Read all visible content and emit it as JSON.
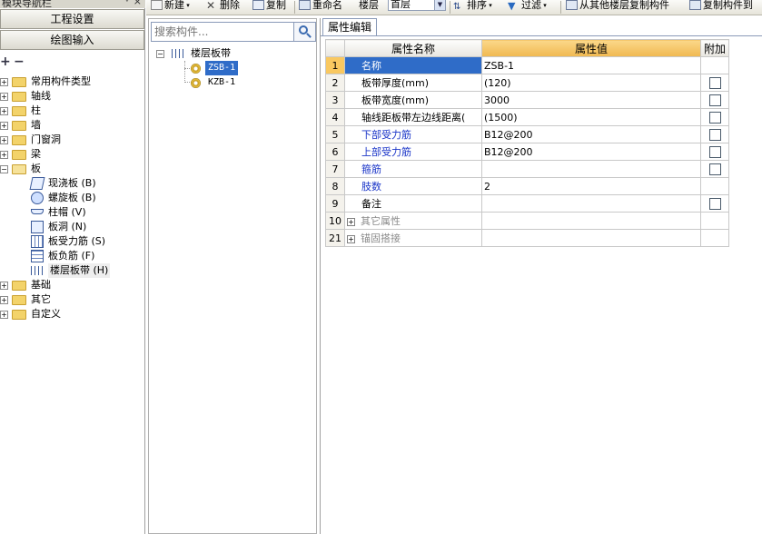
{
  "nav": {
    "title": "模块导航栏",
    "pin": "ᵠ",
    "close": "×",
    "project_settings": "工程设置",
    "drawing_input": "绘图输入",
    "tree": [
      {
        "label": "常用构件类型",
        "expanded": false
      },
      {
        "label": "轴线",
        "expanded": false
      },
      {
        "label": "柱",
        "expanded": false
      },
      {
        "label": "墙",
        "expanded": false
      },
      {
        "label": "门窗洞",
        "expanded": false
      },
      {
        "label": "梁",
        "expanded": false
      },
      {
        "label": "板",
        "expanded": true,
        "children": [
          {
            "label": "现浇板 (B)",
            "icon": "slab-icon"
          },
          {
            "label": "螺旋板 (B)",
            "icon": "spiral-slab-icon"
          },
          {
            "label": "柱帽 (V)",
            "icon": "column-cap-icon"
          },
          {
            "label": "板洞 (N)",
            "icon": "slab-hole-icon"
          },
          {
            "label": "板受力筋 (S)",
            "icon": "slab-rebar-icon"
          },
          {
            "label": "板负筋 (F)",
            "icon": "negative-rebar-icon"
          },
          {
            "label": "楼层板带 (H)",
            "icon": "floor-strip-icon",
            "selected": true
          }
        ]
      },
      {
        "label": "基础",
        "expanded": false
      },
      {
        "label": "其它",
        "expanded": false
      },
      {
        "label": "自定义",
        "expanded": false
      }
    ]
  },
  "toolbar": {
    "new": "新建",
    "delete": "删除",
    "copy": "复制",
    "rename": "重命名",
    "floor_label": "楼层",
    "floor_value": "首层",
    "sort": "排序",
    "filter": "过滤",
    "copy_from_floor": "从其他楼层复制构件",
    "copy_to": "复制构件到"
  },
  "components": {
    "search_placeholder": "搜索构件...",
    "group": "楼层板带",
    "items": [
      {
        "label": "ZSB-1",
        "selected": true
      },
      {
        "label": "KZB-1",
        "selected": false
      }
    ]
  },
  "properties": {
    "tab": "属性编辑",
    "headers": {
      "name": "属性名称",
      "value": "属性值",
      "extra": "附加"
    },
    "rows": [
      {
        "num": "1",
        "name": "名称",
        "value": "ZSB-1",
        "color": "blue",
        "checkbox": false,
        "selected": true
      },
      {
        "num": "2",
        "name": "板带厚度(mm)",
        "value": "(120)",
        "color": "black",
        "checkbox": true
      },
      {
        "num": "3",
        "name": "板带宽度(mm)",
        "value": "3000",
        "color": "black",
        "checkbox": true
      },
      {
        "num": "4",
        "name": "轴线距板带左边线距离(",
        "value": "(1500)",
        "color": "black",
        "checkbox": true
      },
      {
        "num": "5",
        "name": "下部受力筋",
        "value": "B12@200",
        "color": "blue",
        "checkbox": true
      },
      {
        "num": "6",
        "name": "上部受力筋",
        "value": "B12@200",
        "color": "blue",
        "checkbox": true
      },
      {
        "num": "7",
        "name": "箍筋",
        "value": "",
        "color": "blue",
        "checkbox": true
      },
      {
        "num": "8",
        "name": "肢数",
        "value": "2",
        "color": "blue",
        "checkbox": false
      },
      {
        "num": "9",
        "name": "备注",
        "value": "",
        "color": "black",
        "checkbox": true
      },
      {
        "num": "10",
        "name": "其它属性",
        "value": "",
        "color": "gray",
        "checkbox": false,
        "group": true
      },
      {
        "num": "21",
        "name": "锚固搭接",
        "value": "",
        "color": "gray",
        "checkbox": false,
        "group": true
      }
    ]
  }
}
